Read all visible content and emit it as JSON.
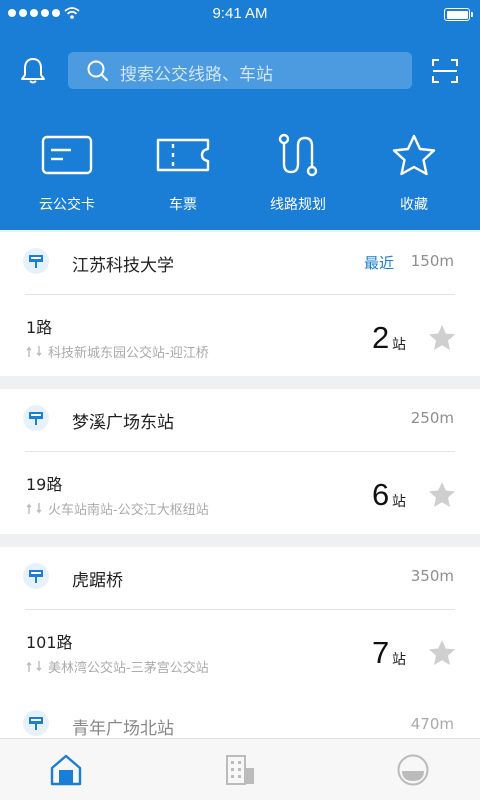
{
  "status_bar": {
    "time": "9:41 AM"
  },
  "search": {
    "placeholder": "搜索公交线路、车站"
  },
  "quick_actions": [
    {
      "label": "云公交卡",
      "icon": "bus-card-icon"
    },
    {
      "label": "车票",
      "icon": "ticket-icon"
    },
    {
      "label": "线路规划",
      "icon": "route-planning-icon"
    },
    {
      "label": "收藏",
      "icon": "favorites-star-icon"
    }
  ],
  "stops": [
    {
      "name": "江苏科技大学",
      "tag": "最近",
      "distance": "150m",
      "route": {
        "name": "1路",
        "path": "科技新城东园公交站-迎江桥",
        "count": "2",
        "unit": "站"
      }
    },
    {
      "name": "梦溪广场东站",
      "tag": "",
      "distance": "250m",
      "route": {
        "name": "19路",
        "path": "火车站南站-公交江大枢纽站",
        "count": "6",
        "unit": "站"
      }
    },
    {
      "name": "虎踞桥",
      "tag": "",
      "distance": "350m",
      "route": {
        "name": "101路",
        "path": "美林湾公交站-三茅宫公交站",
        "count": "7",
        "unit": "站"
      }
    },
    {
      "name": "青年广场北站",
      "tag": "",
      "distance": "470m"
    }
  ],
  "tabbar": {
    "items": [
      {
        "icon": "home-icon",
        "active": true
      },
      {
        "icon": "building-icon",
        "active": false
      },
      {
        "icon": "profile-face-icon",
        "active": false
      }
    ]
  },
  "colors": {
    "primary": "#1a7ed6",
    "star_inactive": "#cfcfcf",
    "text_secondary": "#aaaaaa"
  }
}
